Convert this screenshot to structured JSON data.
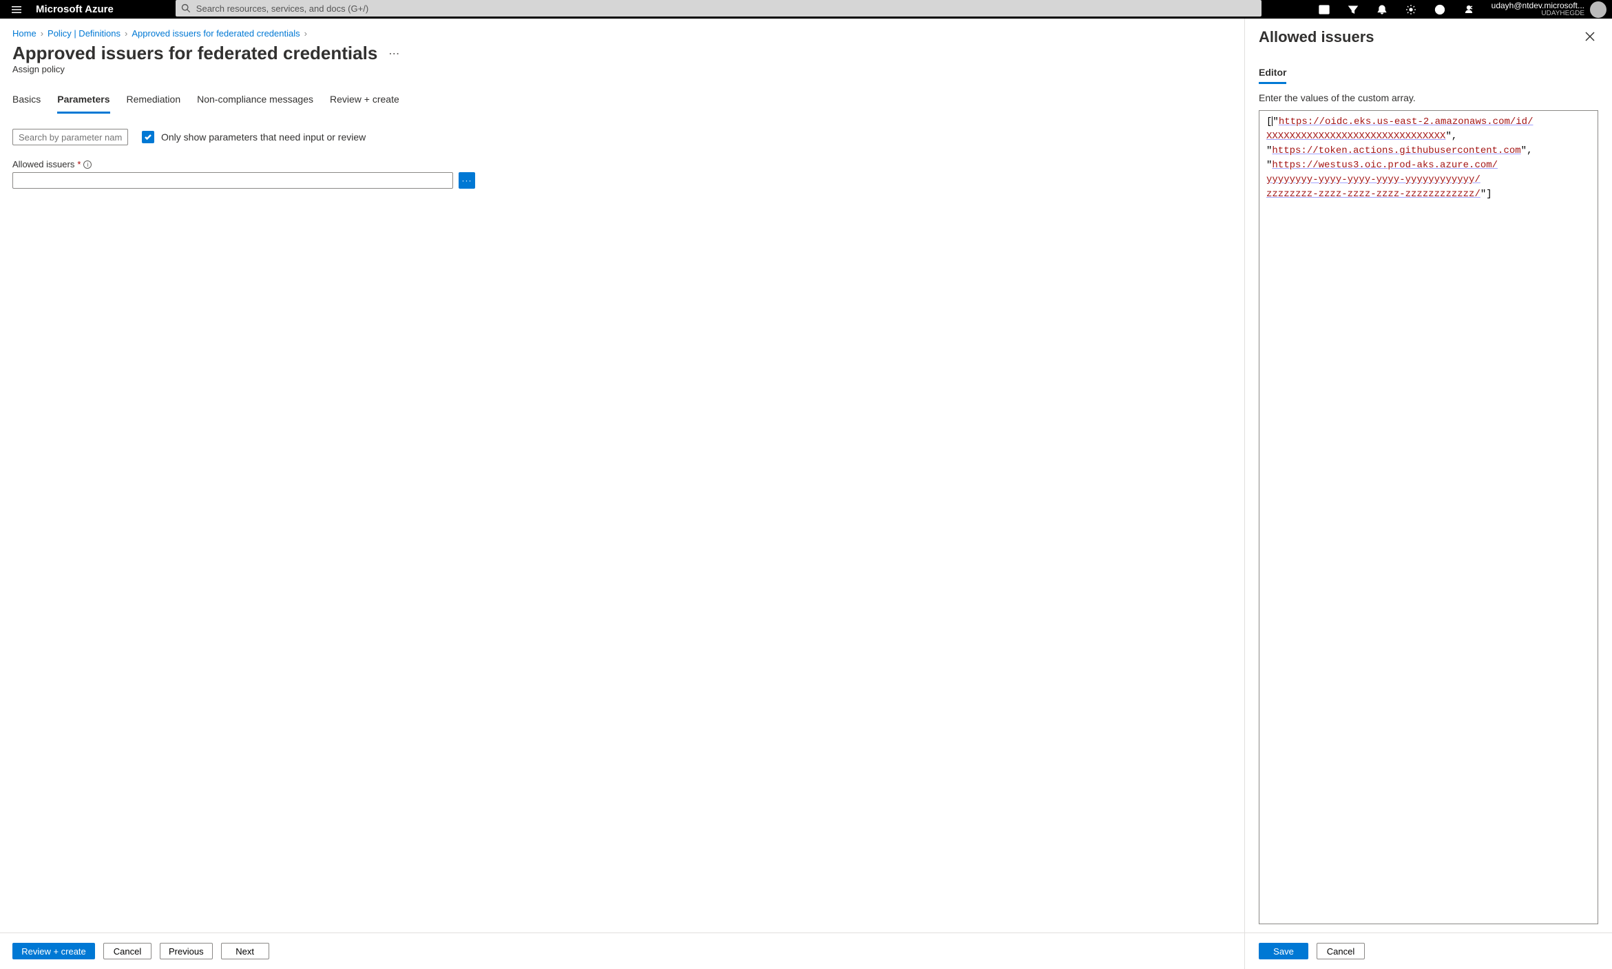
{
  "topbar": {
    "brand": "Microsoft Azure",
    "search_placeholder": "Search resources, services, and docs (G+/)",
    "account_email": "udayh@ntdev.microsoft...",
    "account_dir": "UDAYHEGDE"
  },
  "breadcrumb": {
    "items": [
      "Home",
      "Policy | Definitions",
      "Approved issuers for federated credentials"
    ]
  },
  "page": {
    "title": "Approved issuers for federated credentials",
    "subtitle": "Assign policy"
  },
  "tabs": [
    "Basics",
    "Parameters",
    "Remediation",
    "Non-compliance messages",
    "Review + create"
  ],
  "active_tab": "Parameters",
  "params": {
    "search_placeholder": "Search by parameter name",
    "checkbox_label": "Only show parameters that need input or review",
    "field_label": "Allowed issuers",
    "field_value": ""
  },
  "footer": {
    "review": "Review + create",
    "cancel": "Cancel",
    "previous": "Previous",
    "next": "Next"
  },
  "panel": {
    "title": "Allowed issuers",
    "editor_tab": "Editor",
    "editor_desc": "Enter the values of the custom array.",
    "editor_json": "[\"https://oidc.eks.us-east-2.amazonaws.com/id/XXXXXXXXXXXXXXXXXXXXXXXXXXXXXXX\", \"https://token.actions.githubusercontent.com\", \"https://westus3.oic.prod-aks.azure.com/yyyyyyyy-yyyy-yyyy-yyyy-yyyyyyyyyyyy/zzzzzzzz-zzzz-zzzz-zzzz-zzzzzzzzzzzz/\"]",
    "editor_display": {
      "line1_a": "https://oidc.eks.us-east-2.amazonaws.com/id/",
      "line2": "XXXXXXXXXXXXXXXXXXXXXXXXXXXXXXX",
      "line3": "https://token.actions.githubusercontent.com",
      "line4": "https://westus3.oic.prod-aks.azure.com/",
      "line5": "yyyyyyyy-yyyy-yyyy-yyyy-yyyyyyyyyyyy/",
      "line6": "zzzzzzzz-zzzz-zzzz-zzzz-zzzzzzzzzzzz/"
    },
    "save": "Save",
    "cancel": "Cancel"
  }
}
